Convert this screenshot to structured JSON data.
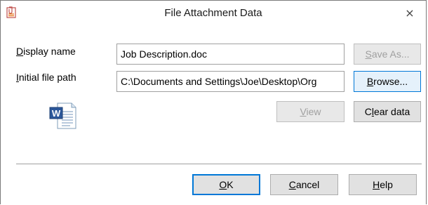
{
  "window": {
    "title": "File Attachment Data",
    "close_label": "×",
    "app_icon": "attachment-app-icon"
  },
  "form": {
    "display_name_label": "Display name",
    "display_name_value": "Job Description.doc",
    "initial_path_label": "Initial file path",
    "initial_path_value": "C:\\Documents and Settings\\Joe\\Desktop\\Org",
    "file_icon": "word-document-icon"
  },
  "buttons": {
    "save_as": "Save As...",
    "browse": "Browse...",
    "view": "View",
    "clear_data": "Clear data",
    "ok": "OK",
    "cancel": "Cancel",
    "help": "Help"
  },
  "colors": {
    "focus_accent": "#0078d7",
    "button_face": "#e1e1e1",
    "disabled_text": "#a0a0a0"
  }
}
